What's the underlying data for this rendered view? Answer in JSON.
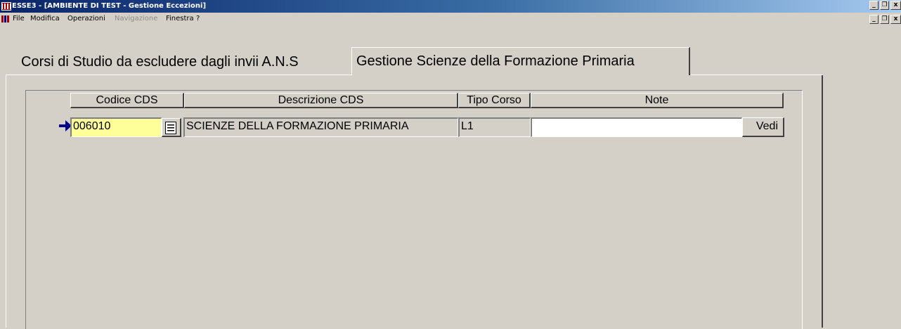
{
  "window": {
    "title": "ESSE3 - [AMBIENTE DI TEST - Gestione Eccezioni]",
    "controls": {
      "minimize": "_",
      "restore": "❐",
      "close": "x"
    }
  },
  "menu": {
    "items": [
      {
        "label": "File",
        "enabled": true
      },
      {
        "label": "Modifica",
        "enabled": true
      },
      {
        "label": "Operazioni",
        "enabled": true
      },
      {
        "label": "Navigazione",
        "enabled": false
      },
      {
        "label": "Finestra",
        "enabled": true
      },
      {
        "label": "?",
        "enabled": true
      }
    ]
  },
  "tabs": [
    {
      "label": "Corsi di Studio da escludere dagli invii A.N.S",
      "active": false
    },
    {
      "label": "Gestione Scienze della Formazione Primaria",
      "active": true
    }
  ],
  "table": {
    "columns": [
      "Codice CDS",
      "Descrizione CDS",
      "Tipo Corso",
      "Note"
    ],
    "rows": [
      {
        "codice": "006010",
        "descrizione": "SCIENZE DELLA FORMAZIONE PRIMARIA",
        "tipo": "L1",
        "note": ""
      }
    ],
    "vedi_label": "Vedi"
  },
  "colors": {
    "codice_field_bg": "#ffff99",
    "readonly_field_bg": "#d4d0c8",
    "note_field_bg": "#ffffff",
    "record_arrow": "#00008b"
  },
  "icons": {
    "app": "esse3-app-icon",
    "menu": "books-icon",
    "record_indicator": "arrow-right-icon",
    "lov": "list-values-icon"
  }
}
